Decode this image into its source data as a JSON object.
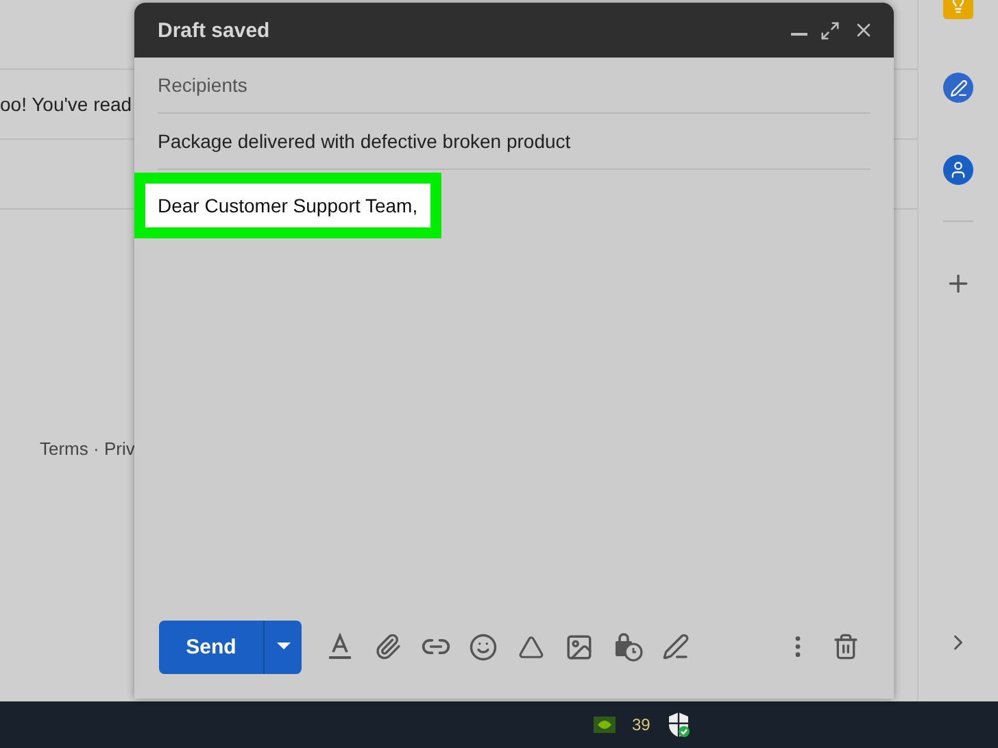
{
  "background": {
    "message_snippet": "oo! You've read",
    "footer_links": "Terms · Priv"
  },
  "compose": {
    "title": "Draft saved",
    "recipients": {
      "placeholder": "Recipients"
    },
    "subject": {
      "value": "Package delivered with defective broken product"
    },
    "body": {
      "text": "Dear Customer Support Team,",
      "highlighted": true
    },
    "send_button": "Send"
  },
  "taskbar": {
    "temperature": "39"
  }
}
